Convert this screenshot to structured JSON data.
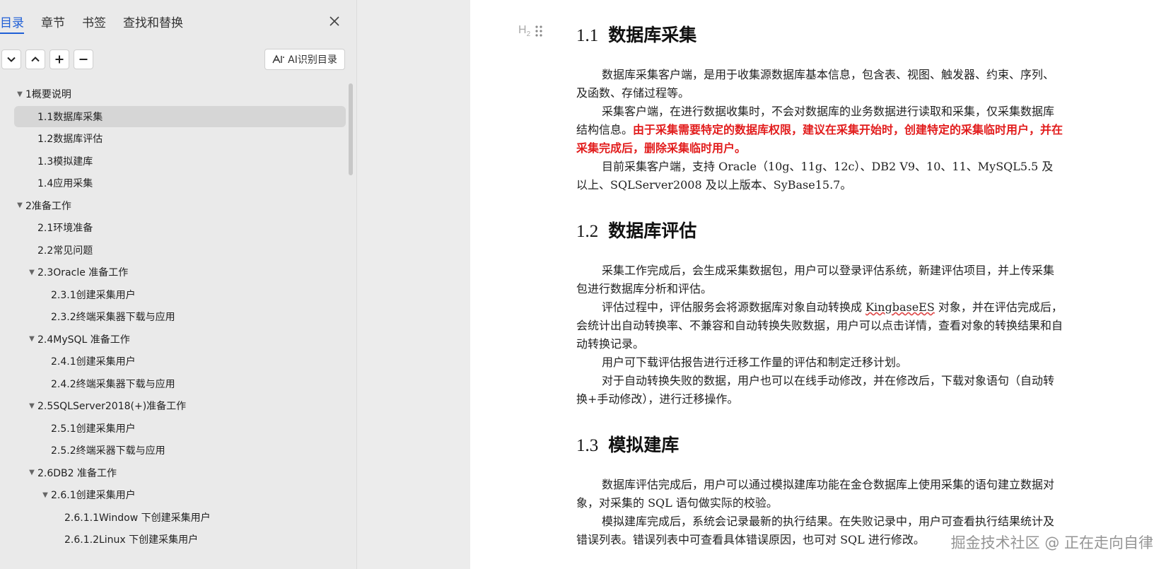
{
  "nav": {
    "tabs": [
      {
        "label": "目录",
        "active": true
      },
      {
        "label": "章节",
        "active": false
      },
      {
        "label": "书签",
        "active": false
      },
      {
        "label": "查找和替换",
        "active": false
      }
    ],
    "ai_button_label": "AI识别目录",
    "toc": [
      {
        "label": "1概要说明",
        "level": 0,
        "caret": true,
        "selected": false
      },
      {
        "label": "1.1数据库采集",
        "level": 1,
        "caret": false,
        "selected": true
      },
      {
        "label": "1.2数据库评估",
        "level": 1,
        "caret": false,
        "selected": false
      },
      {
        "label": "1.3模拟建库",
        "level": 1,
        "caret": false,
        "selected": false
      },
      {
        "label": "1.4应用采集",
        "level": 1,
        "caret": false,
        "selected": false
      },
      {
        "label": "2准备工作",
        "level": 0,
        "caret": true,
        "selected": false
      },
      {
        "label": "2.1环境准备",
        "level": 1,
        "caret": false,
        "selected": false
      },
      {
        "label": "2.2常见问题",
        "level": 1,
        "caret": false,
        "selected": false
      },
      {
        "label": "2.3Oracle 准备工作",
        "level": 1,
        "caret": true,
        "selected": false
      },
      {
        "label": "2.3.1创建采集用户",
        "level": 2,
        "caret": false,
        "selected": false
      },
      {
        "label": "2.3.2终端采集器下载与应用",
        "level": 2,
        "caret": false,
        "selected": false
      },
      {
        "label": "2.4MySQL 准备工作",
        "level": 1,
        "caret": true,
        "selected": false
      },
      {
        "label": "2.4.1创建采集用户",
        "level": 2,
        "caret": false,
        "selected": false
      },
      {
        "label": "2.4.2终端采集器下载与应用",
        "level": 2,
        "caret": false,
        "selected": false
      },
      {
        "label": "2.5SQLServer2018(+)准备工作",
        "level": 1,
        "caret": true,
        "selected": false
      },
      {
        "label": "2.5.1创建采集用户",
        "level": 2,
        "caret": false,
        "selected": false
      },
      {
        "label": "2.5.2终端采器下载与应用",
        "level": 2,
        "caret": false,
        "selected": false
      },
      {
        "label": "2.6DB2 准备工作",
        "level": 1,
        "caret": true,
        "selected": false
      },
      {
        "label": "2.6.1创建采集用户",
        "level": 2,
        "caret": true,
        "selected": false
      },
      {
        "label": "2.6.1.1Window 下创建采集用户",
        "level": 3,
        "caret": false,
        "selected": false
      },
      {
        "label": "2.6.1.2Linux 下创建采集用户",
        "level": 3,
        "caret": false,
        "selected": false
      }
    ]
  },
  "doc": {
    "heading_tag": "H",
    "heading_tag_sub": "2",
    "s1": {
      "num": "1.1",
      "title": "数据库采集",
      "p1": "数据库采集客户端，是用于收集源数据库基本信息，包含表、视图、触发器、约束、序列、及函数、存储过程等。",
      "p2_normal": "采集客户端，在进行数据收集时，不会对数据库的业务数据进行读取和采集，仅采集数据库结构信息。",
      "p2_red": "由于采集需要特定的数据库权限，建议在采集开始时，创建特定的采集临时用户，并在采集完成后，删除采集临时用户。",
      "p3": "目前采集客户端，支持 Oracle（10g、11g、12c）、DB2 V9、10、11、MySQL5.5 及以上、SQLServer2008 及以上版本、SyBase15.7。"
    },
    "s2": {
      "num": "1.2",
      "title": "数据库评估",
      "p1": "采集工作完成后，会生成采集数据包，用户可以登录评估系统，新建评估项目，并上传采集包进行数据库分析和评估。",
      "p2_a": "评估过程中，评估服务会将源数据库对象自动转换成 ",
      "p2_link": "KingbaseES",
      "p2_b": " 对象，并在评估完成后，会统计出自动转换率、不兼容和自动转换失败数据，用户可以点击详情，查看对象的转换结果和自动转换记录。",
      "p3": "用户可下载评估报告进行迁移工作量的评估和制定迁移计划。",
      "p4": "对于自动转换失败的数据，用户也可以在线手动修改，并在修改后，下载对象语句（自动转换+手动修改），进行迁移操作。"
    },
    "s3": {
      "num": "1.3",
      "title": "模拟建库",
      "p1": "数据库评估完成后，用户可以通过模拟建库功能在金仓数据库上使用采集的语句建立数据对象，对采集的 SQL 语句做实际的校验。",
      "p2": "模拟建库完成后，系统会记录最新的执行结果。在失败记录中，用户可查看执行结果统计及错误列表。错误列表中可查看具体错误原因，也可对 SQL 进行修改。"
    }
  },
  "watermark": "掘金技术社区 @ 正在走向自律"
}
